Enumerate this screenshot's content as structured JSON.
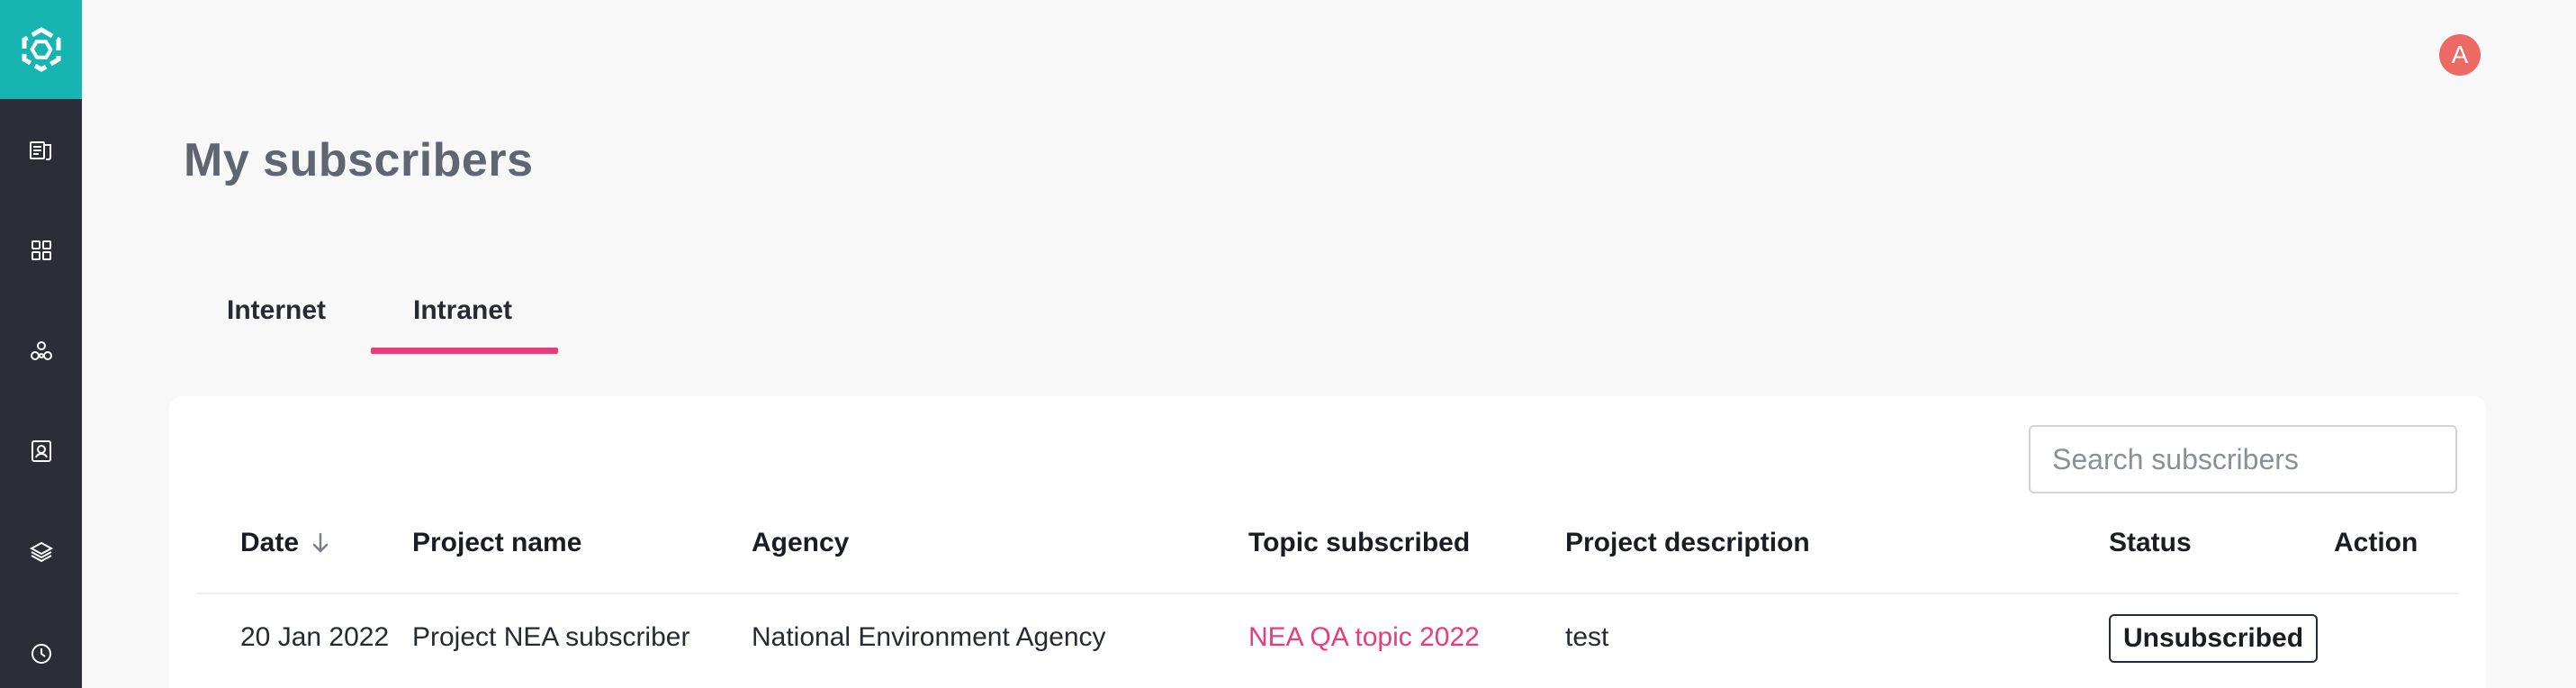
{
  "sidebar": {
    "logo": "app-logo",
    "icons": [
      "documents-icon",
      "apps-grid-icon",
      "network-icon",
      "contacts-icon",
      "layers-icon",
      "clock-icon"
    ]
  },
  "header": {
    "avatar_initial": "A"
  },
  "page": {
    "title": "My subscribers"
  },
  "tabs": [
    {
      "label": "Internet",
      "active": false
    },
    {
      "label": "Intranet",
      "active": true
    }
  ],
  "search": {
    "placeholder": "Search subscribers",
    "value": ""
  },
  "table": {
    "columns": [
      "Date",
      "Project name",
      "Agency",
      "Topic subscribed",
      "Project description",
      "Status",
      "Action"
    ],
    "sort": {
      "column": "Date",
      "direction": "descending"
    },
    "rows": [
      {
        "date": "20 Jan 2022",
        "project_name": "Project NEA subscriber",
        "agency": "National Environment Agency",
        "topic": "NEA QA topic 2022",
        "description": "test",
        "status": "Unsubscribed",
        "action": ""
      }
    ]
  },
  "colors": {
    "accent": "#ea3c7c",
    "brand": "#16b5b2",
    "sidebar": "#2b2e37",
    "avatar": "#ec6a63"
  }
}
